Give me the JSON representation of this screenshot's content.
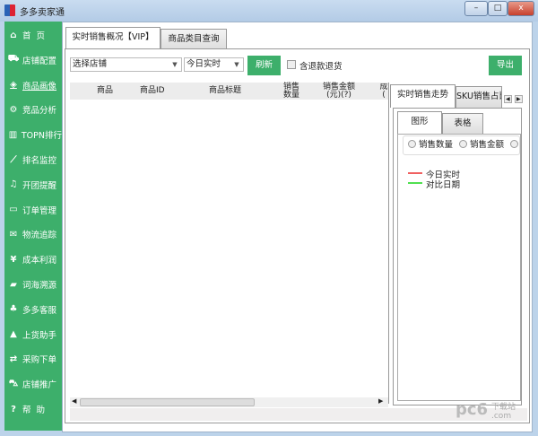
{
  "window": {
    "title": "多多卖家通",
    "min": "–",
    "max": "□",
    "close": "x"
  },
  "sidebar": {
    "items": [
      {
        "icon": "home-icon",
        "glyph": "⌂",
        "label": "首  页"
      },
      {
        "icon": "cart-icon",
        "glyph": "⛟",
        "label": "店铺配置"
      },
      {
        "icon": "cube-icon",
        "glyph": "◈",
        "label": "商品画像"
      },
      {
        "icon": "analysis-icon",
        "glyph": "⚙",
        "label": "竞品分析"
      },
      {
        "icon": "bar-chart-icon",
        "glyph": "▥",
        "label": "TOPN排行"
      },
      {
        "icon": "line-chart-icon",
        "glyph": "⟋",
        "label": "排名监控"
      },
      {
        "icon": "bell-icon",
        "glyph": "♫",
        "label": "开团提醒"
      },
      {
        "icon": "folder-icon",
        "glyph": "▭",
        "label": "订单管理"
      },
      {
        "icon": "mail-icon",
        "glyph": "✉",
        "label": "物流追踪"
      },
      {
        "icon": "yen-icon",
        "glyph": "¥",
        "label": "成本利润"
      },
      {
        "icon": "book-icon",
        "glyph": "▰",
        "label": "词海溯源"
      },
      {
        "icon": "service-icon",
        "glyph": "♣",
        "label": "多多客服"
      },
      {
        "icon": "road-icon",
        "glyph": "▲",
        "label": "上货助手"
      },
      {
        "icon": "exchange-icon",
        "glyph": "⇄",
        "label": "采购下单"
      },
      {
        "icon": "car-icon",
        "glyph": "⛍",
        "label": "店铺推广"
      },
      {
        "icon": "help-icon",
        "glyph": "?",
        "label": "帮  助"
      }
    ]
  },
  "tabs": [
    "实时销售概况【VIP】",
    "商品类目查询"
  ],
  "toolbar": {
    "shop": "选择店铺",
    "period": "今日实时",
    "refresh": "刷新",
    "refund_label": "含退款退货",
    "export": "导出"
  },
  "table": {
    "headers": [
      "商品",
      "商品ID",
      "商品标题",
      "销售\n数量",
      "销售金额\n(元)(?)",
      "成\n("
    ]
  },
  "right": {
    "tabs": [
      "实时销售走势",
      "SKU销售占比"
    ],
    "subtabs": [
      "图形",
      "表格"
    ],
    "radios": [
      "销售数量",
      "销售金额"
    ],
    "legend": [
      {
        "label": "今日实时",
        "color": "#f06060"
      },
      {
        "label": "对比日期",
        "color": "#50e050"
      }
    ]
  },
  "watermark": "pc6下载站.com"
}
